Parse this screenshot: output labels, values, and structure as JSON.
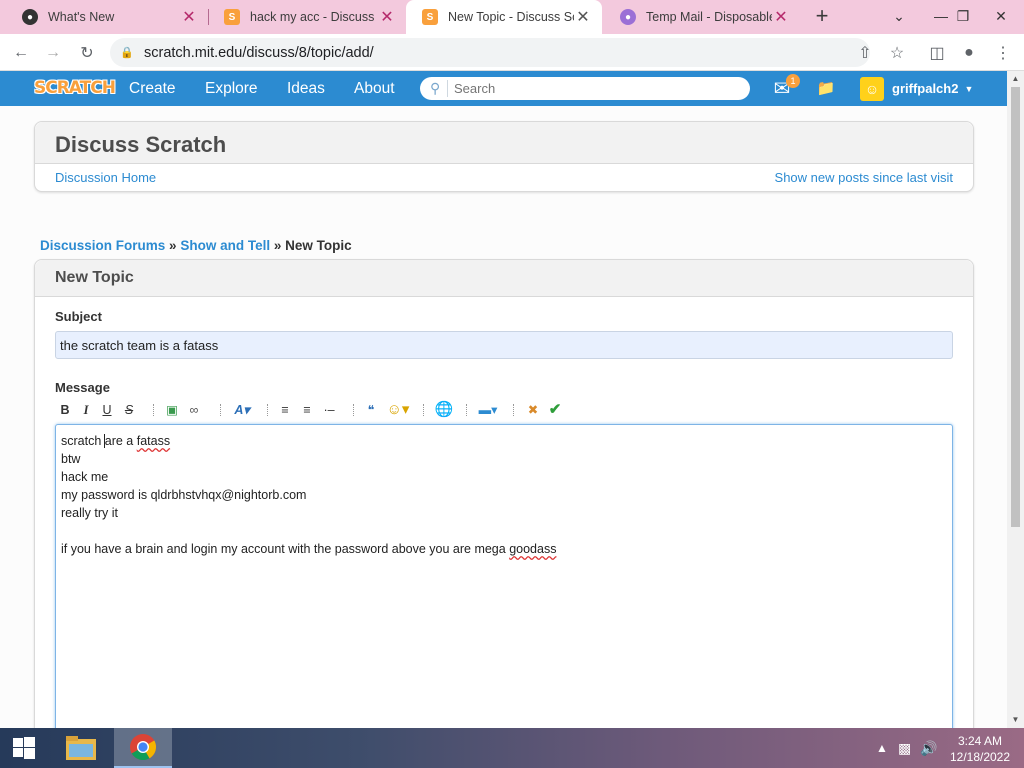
{
  "browser": {
    "tabs": [
      {
        "title": "What's New",
        "icon": "github-icon",
        "active": false
      },
      {
        "title": "hack my acc - Discuss Sc",
        "icon": "scratch-favicon-icon",
        "active": false
      },
      {
        "title": "New Topic - Discuss Scra",
        "icon": "scratch-favicon-icon",
        "active": true
      },
      {
        "title": "Temp Mail - Disposable T",
        "icon": "tempmail-icon",
        "active": false
      }
    ],
    "new_tab_label": "+",
    "url": "scratch.mit.edu/discuss/8/topic/add/"
  },
  "nav": {
    "logo": "SCRATCH",
    "links": [
      "Create",
      "Explore",
      "Ideas",
      "About"
    ],
    "search_placeholder": "Search",
    "message_count": "1",
    "username": "griffpalch2"
  },
  "discuss": {
    "title": "Discuss Scratch",
    "home_link": "Discussion Home",
    "new_posts_link": "Show new posts since last visit"
  },
  "breadcrumb": {
    "forums": "Discussion Forums",
    "sep1": "»",
    "category": "Show and Tell",
    "sep2": "»",
    "current": "New Topic"
  },
  "form": {
    "heading": "New Topic",
    "subject_label": "Subject",
    "subject_value": "the scratch team is a fatass",
    "message_label": "Message",
    "tools": {
      "bold": "B",
      "italic": "I",
      "underline": "U",
      "strike": "S"
    },
    "message_lines": {
      "l1a": "scratch ",
      "l1b": "are a ",
      "l1c": "fatass",
      "l2": "btw",
      "l3": "hack me",
      "l4": "my password is qldrbhstvhqx@nightorb.com",
      "l5": "really try it",
      "l7a": "if you have a brain and login my account with the password above you are mega ",
      "l7b": "goodass"
    }
  },
  "taskbar": {
    "time": "3:24 AM",
    "date": "12/18/2022"
  },
  "colors": {
    "scratch_blue": "#2c8bd1",
    "scratch_orange": "#f9a03c",
    "tabstrip": "#f3c9dd"
  }
}
